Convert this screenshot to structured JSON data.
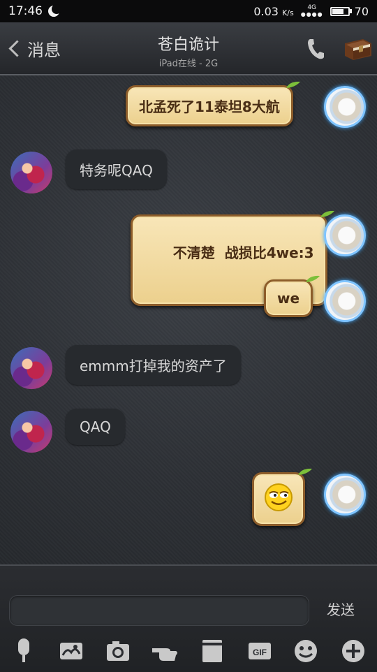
{
  "status_bar": {
    "time": "17:46",
    "net_speed": "0.03",
    "speed_unit": "K/s",
    "net_type": "4G",
    "battery": "70"
  },
  "header": {
    "back_label": "消息",
    "title": "苍白诡计",
    "subtitle": "iPad在线 - 2G"
  },
  "messages": [
    {
      "side": "out",
      "text": "北孟死了11泰坦8大航"
    },
    {
      "side": "in",
      "text": "特务呢QAQ"
    },
    {
      "side": "out",
      "text": "不清楚  战损比4we:3"
    },
    {
      "side": "out",
      "text": "we"
    },
    {
      "side": "in",
      "text": "emmm打掉我的资产了"
    },
    {
      "side": "in",
      "text": "QAQ"
    },
    {
      "side": "out",
      "emoji": "smirk-emoji"
    }
  ],
  "input": {
    "placeholder": "",
    "send_label": "发送"
  },
  "toolbar": [
    "microphone-icon",
    "sticker-icon",
    "camera-icon",
    "poke-icon",
    "file-icon",
    "gif-icon",
    "emoji-icon",
    "plus-icon"
  ],
  "colors": {
    "bubble_out": "#f3dea3",
    "bubble_border": "#8d5d2a",
    "bubble_in": "#272a2e",
    "avatar_ring": "#7fc4ff"
  }
}
